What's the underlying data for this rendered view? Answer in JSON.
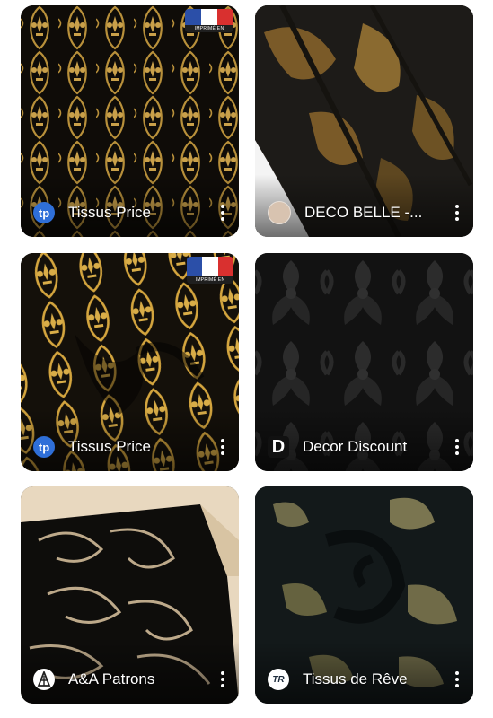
{
  "pins": [
    {
      "source": "Tissus Price",
      "avatar_text": "tp",
      "avatar_color": "#2f6fd8",
      "flag_caption": "IMPRIMÉ EN FRANCE",
      "image_desc": "black-gold fleur-de-lis fabric"
    },
    {
      "source": "DECO BELLE -...",
      "avatar_text": "",
      "avatar_color": "#d8c3b0",
      "image_desc": "black-gold damask drape"
    },
    {
      "source": "Tissus Price",
      "avatar_text": "tp",
      "avatar_color": "#2f6fd8",
      "flag_caption": "IMPRIMÉ EN FRANCE",
      "image_desc": "gold swirl fleur fabric"
    },
    {
      "source": "Decor Discount",
      "avatar_text": "D",
      "avatar_color": "#111111",
      "image_desc": "black damask fabric"
    },
    {
      "source": "A&A Patrons",
      "avatar_text": "A",
      "avatar_color": "#222222",
      "image_desc": "black with gold scroll fabric"
    },
    {
      "source": "Tissus de Rêve",
      "avatar_text": "TR",
      "avatar_color": "#ffffff",
      "image_desc": "dark green gold brocade swirl"
    }
  ],
  "colors": {
    "flag_blue": "#2b4fa8",
    "flag_white": "#ffffff",
    "flag_red": "#d9302f",
    "gold": "#b8903a"
  }
}
